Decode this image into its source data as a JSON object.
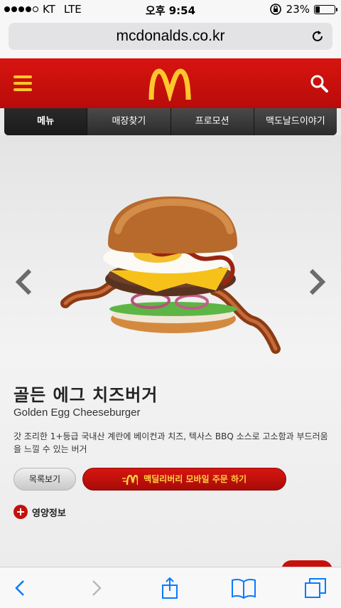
{
  "status_bar": {
    "carrier": "KT",
    "network": "LTE",
    "time": "오후 9:54",
    "battery_percent": "23%",
    "battery_level": 0.23
  },
  "browser": {
    "url": "mcdonalds.co.kr"
  },
  "header": {
    "brand_color": "#c8100b",
    "accent_color": "#ffc72c"
  },
  "tabs": [
    {
      "label": "메뉴"
    },
    {
      "label": "매장찾기"
    },
    {
      "label": "프로모션"
    },
    {
      "label": "맥도날드이야기"
    }
  ],
  "product": {
    "title_ko": "골든 에그 치즈버거",
    "title_en": "Golden Egg Cheeseburger",
    "description": "갓 조리한 1+등급 국내산 계란에 베이컨과 치즈, 텍사스 BBQ 소스로 고소함과 부드러움을 느낄 수 있는 버거",
    "list_button": "목록보기",
    "order_button": "맥딜리버리 모바일 주문 하기",
    "nutrition_label": "영양정보"
  },
  "icons": {
    "menu": "hamburger-menu-icon",
    "search": "search-icon",
    "prev": "chevron-left-icon",
    "next": "chevron-right-icon",
    "back": "back-icon",
    "forward": "forward-icon",
    "share": "share-icon",
    "bookmarks": "bookmarks-icon",
    "tabs": "tabs-icon"
  }
}
